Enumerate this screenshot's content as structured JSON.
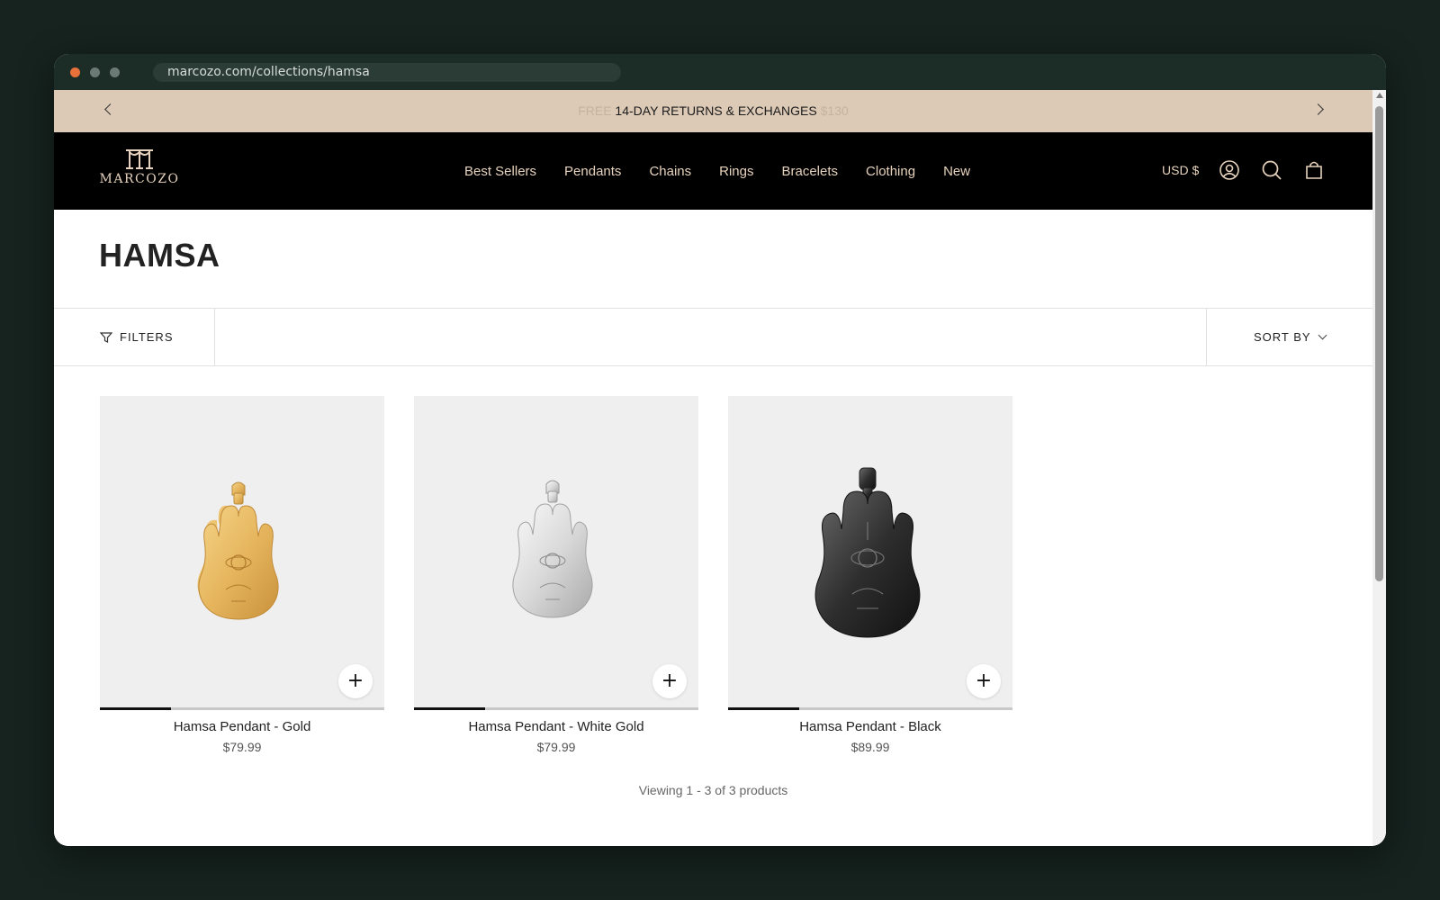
{
  "browser": {
    "url": "marcozo.com/collections/hamsa"
  },
  "announcement": {
    "prev_ghost": "FREE",
    "message": "14-DAY RETURNS & EXCHANGES",
    "next_ghost": "$130",
    "colors": {
      "background": "#dcc9b6",
      "text": "#1b1b1b"
    }
  },
  "header": {
    "logo_text": "MARCOZO",
    "nav": [
      "Best Sellers",
      "Pendants",
      "Chains",
      "Rings",
      "Bracelets",
      "Clothing",
      "New"
    ],
    "currency": "USD $",
    "icons": [
      "account-icon",
      "search-icon",
      "cart-icon"
    ],
    "colors": {
      "background": "#000000",
      "text": "#e7d3bd"
    }
  },
  "collection": {
    "title": "HAMSA"
  },
  "toolbar": {
    "filters_label": "FILTERS",
    "sort_label": "SORT BY"
  },
  "products": [
    {
      "name": "Hamsa Pendant - Gold",
      "price": "$79.99",
      "finish": "gold",
      "image_progress": 0.25
    },
    {
      "name": "Hamsa Pendant - White Gold",
      "price": "$79.99",
      "finish": "white-gold",
      "image_progress": 0.25
    },
    {
      "name": "Hamsa Pendant - Black",
      "price": "$89.99",
      "finish": "black",
      "image_progress": 0.25
    }
  ],
  "pagination": {
    "summary": "Viewing 1 - 3 of 3 products"
  }
}
